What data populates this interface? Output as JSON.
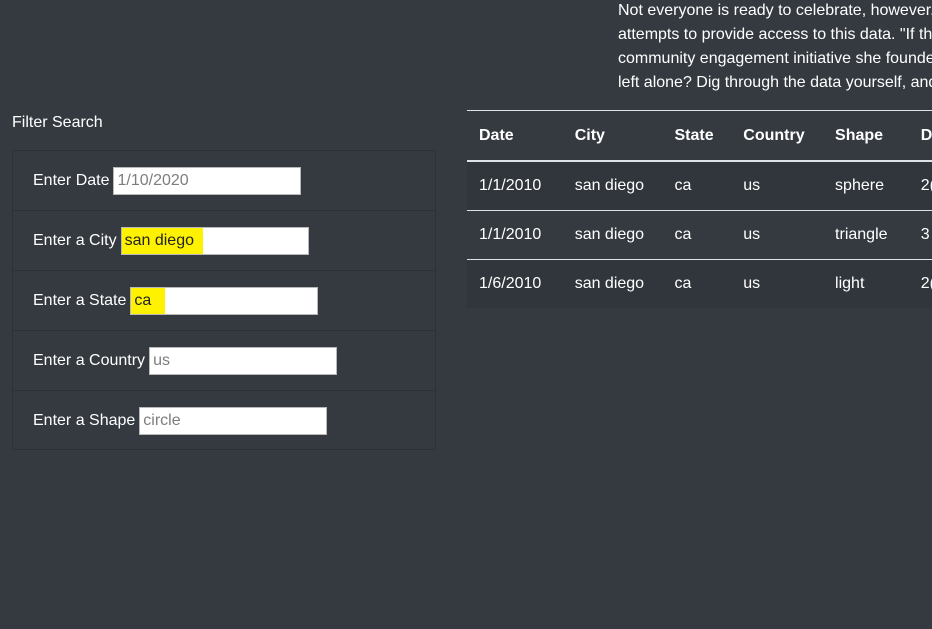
{
  "intro": {
    "lines": [
      "Not everyone is ready to celebrate, however.",
      "attempts to provide access to this data. \"If th",
      "community engagement initiative she founde",
      "left alone? Dig through the data yourself, and"
    ]
  },
  "filter": {
    "title": "Filter Search",
    "fields": [
      {
        "label": "Enter Date",
        "value": "",
        "placeholder": "1/10/2020",
        "highlighted": false
      },
      {
        "label": "Enter a City",
        "value": "san diego",
        "placeholder": "",
        "highlighted": true
      },
      {
        "label": "Enter a State",
        "value": "ca",
        "placeholder": "",
        "highlighted": true
      },
      {
        "label": "Enter a Country",
        "value": "",
        "placeholder": "us",
        "highlighted": false
      },
      {
        "label": "Enter a Shape",
        "value": "",
        "placeholder": "circle",
        "highlighted": false
      }
    ]
  },
  "table": {
    "headers": [
      "Date",
      "City",
      "State",
      "Country",
      "Shape",
      "D"
    ],
    "rows": [
      [
        "1/1/2010",
        "san diego",
        "ca",
        "us",
        "sphere",
        "2("
      ],
      [
        "1/1/2010",
        "san diego",
        "ca",
        "us",
        "triangle",
        "3"
      ],
      [
        "1/6/2010",
        "san diego",
        "ca",
        "us",
        "light",
        "2("
      ]
    ]
  },
  "colors": {
    "background": "#343a40",
    "highlight": "#fff200",
    "text": "#ffffff"
  }
}
